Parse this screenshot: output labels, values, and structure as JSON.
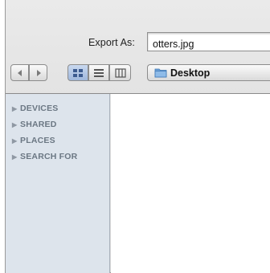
{
  "export": {
    "label": "Export As:",
    "filename": "otters.jpg"
  },
  "toolbar": {
    "nav_back_icon": "chevron-left-icon",
    "nav_forward_icon": "chevron-right-icon",
    "view_modes": [
      "icon-view",
      "list-view",
      "column-view"
    ],
    "location": "Desktop"
  },
  "sidebar": {
    "items": [
      {
        "label": "DEVICES"
      },
      {
        "label": "SHARED"
      },
      {
        "label": "PLACES"
      },
      {
        "label": "SEARCH FOR"
      }
    ]
  },
  "colors": {
    "sidebar_bg": "#dde4ec",
    "sidebar_text": "#6b7783",
    "selected_segment": "#9fb7dc"
  }
}
